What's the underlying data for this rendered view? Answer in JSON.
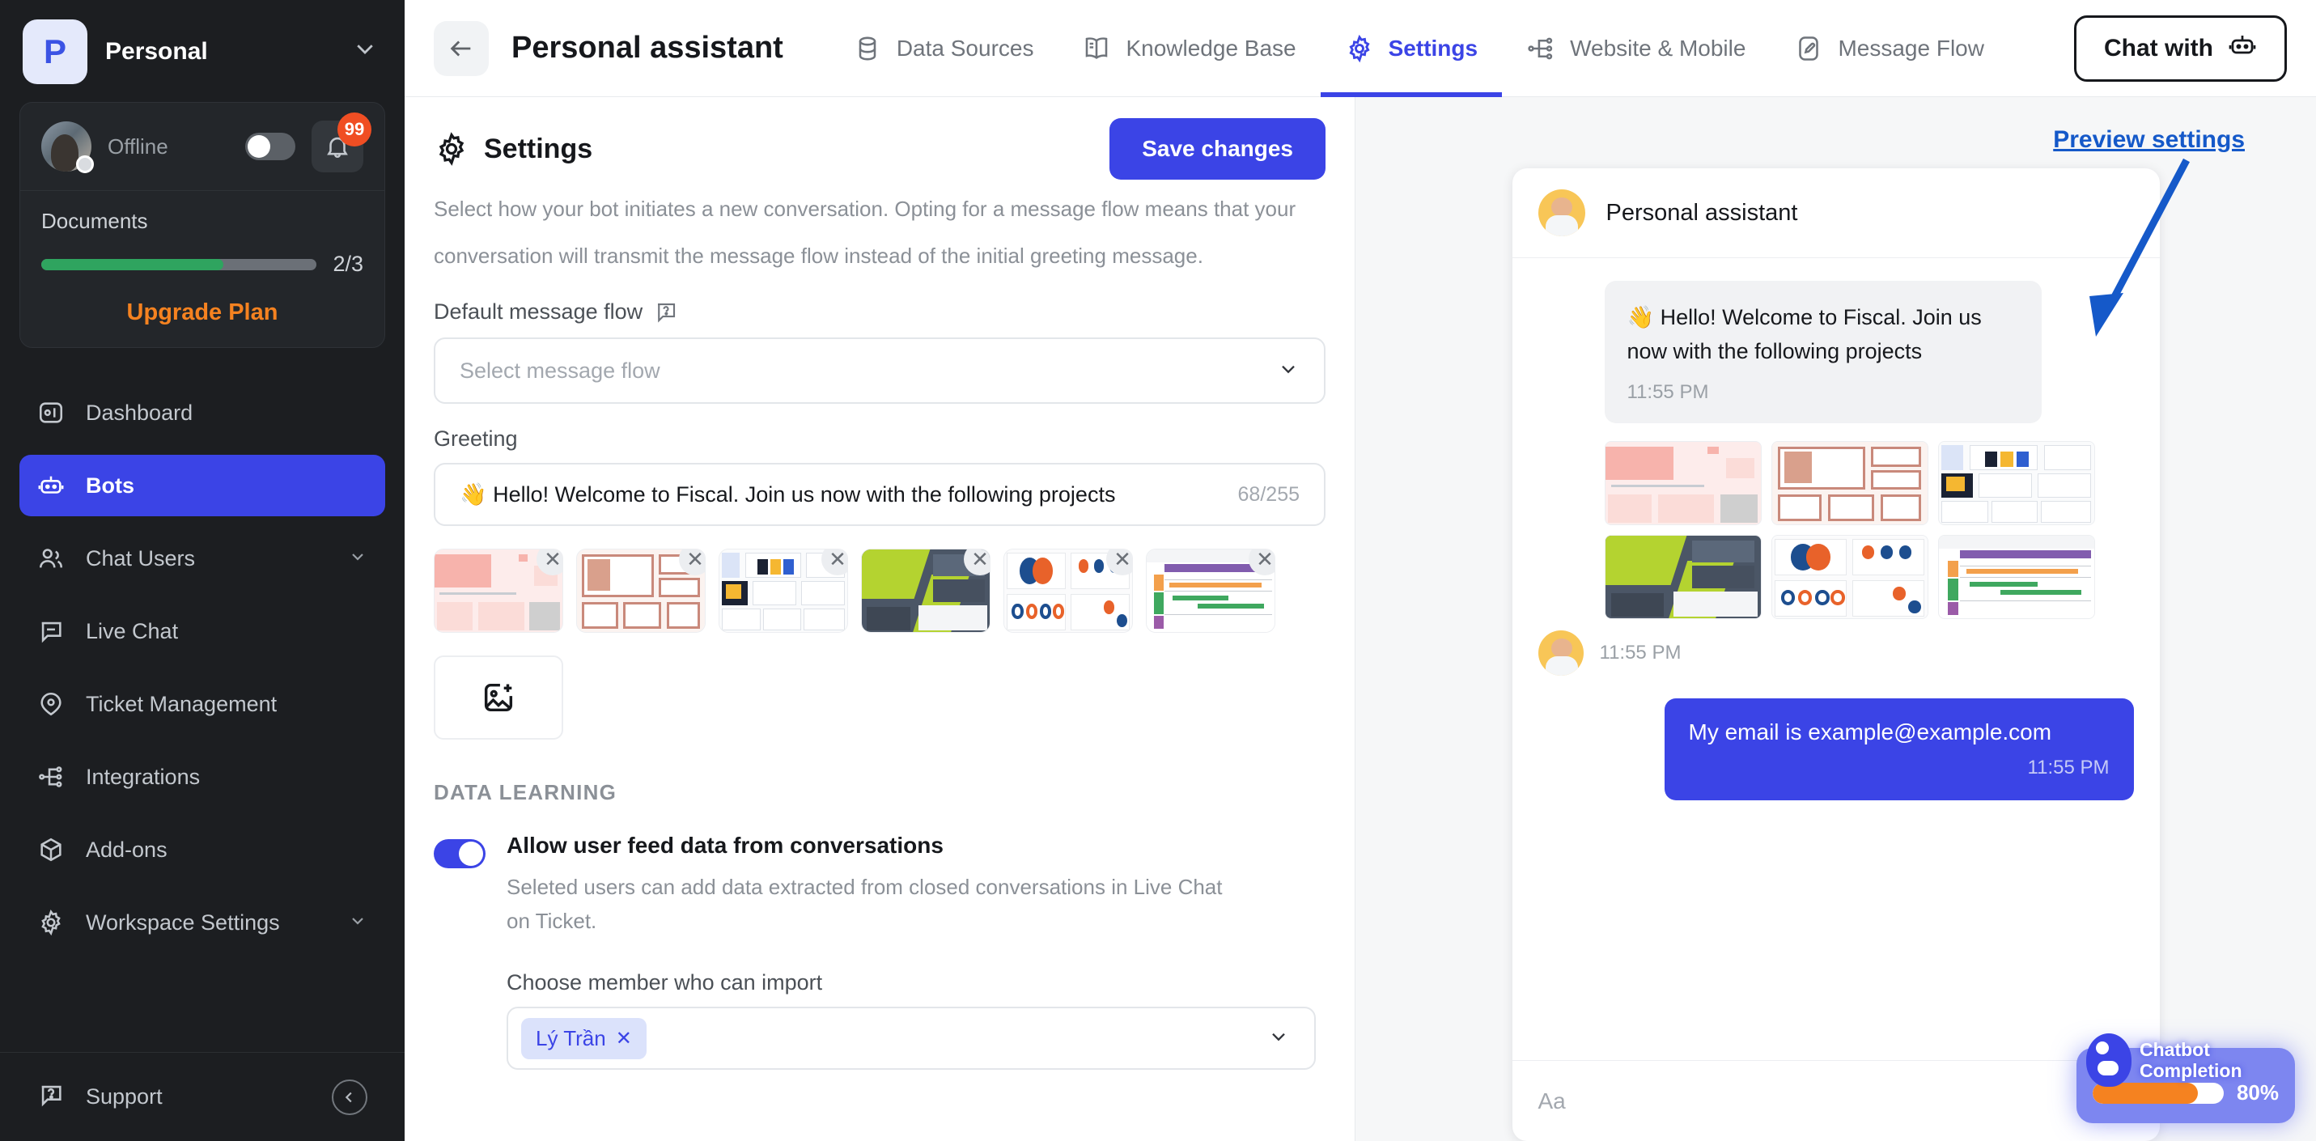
{
  "sidebar": {
    "workspace": {
      "initial": "P",
      "name": "Personal",
      "caret_icon": "chevron-down-icon"
    },
    "status": {
      "label": "Offline",
      "toggle_state": "off",
      "notification_count": "99",
      "bell_icon": "bell-icon"
    },
    "documents": {
      "label": "Documents",
      "count_text": "2/3",
      "progress_percent": 66,
      "upgrade_label": "Upgrade Plan"
    },
    "items": [
      {
        "label": "Dashboard",
        "icon": "dashboard-icon",
        "active": false,
        "expandable": false
      },
      {
        "label": "Bots",
        "icon": "robot-icon",
        "active": true,
        "expandable": false
      },
      {
        "label": "Chat Users",
        "icon": "users-icon",
        "active": false,
        "expandable": true
      },
      {
        "label": "Live Chat",
        "icon": "chat-bubble-icon",
        "active": false,
        "expandable": false
      },
      {
        "label": "Ticket Management",
        "icon": "tag-icon",
        "active": false,
        "expandable": false
      },
      {
        "label": "Integrations",
        "icon": "nodes-icon",
        "active": false,
        "expandable": false
      },
      {
        "label": "Add-ons",
        "icon": "box-icon",
        "active": false,
        "expandable": false
      },
      {
        "label": "Workspace Settings",
        "icon": "gear-icon",
        "active": false,
        "expandable": true
      }
    ],
    "footer": {
      "support_label": "Support",
      "support_icon": "question-bubble-icon",
      "collapse_icon": "chevron-left-icon"
    }
  },
  "topbar": {
    "back_icon": "arrow-left-icon",
    "bot_title": "Personal assistant",
    "tabs": [
      {
        "label": "Data Sources",
        "icon": "database-icon",
        "active": false
      },
      {
        "label": "Knowledge Base",
        "icon": "book-icon",
        "active": false
      },
      {
        "label": "Settings",
        "icon": "gear-icon",
        "active": true
      },
      {
        "label": "Website & Mobile",
        "icon": "nodes-icon",
        "active": false
      },
      {
        "label": "Message Flow",
        "icon": "pen-square-icon",
        "active": false
      }
    ],
    "chat_with": {
      "label": "Chat with",
      "icon": "robot-icon"
    }
  },
  "settings": {
    "title": "Settings",
    "title_icon": "gear-icon",
    "save_label": "Save changes",
    "description_clipped": "Select how your bot initiates a new conversation. Opting for a message flow means that your",
    "description_line2": "conversation will transmit the message flow instead of the initial greeting message.",
    "message_flow": {
      "label": "Default message flow",
      "help_icon": "question-icon",
      "placeholder": "Select message flow",
      "caret_icon": "chevron-down-icon"
    },
    "greeting": {
      "label": "Greeting",
      "value": "👋 Hello! Welcome to Fiscal. Join us now with the following projects",
      "char_count": "68/255"
    },
    "attachments": [
      {
        "name": "slide-pink-presentation-title",
        "style": "pink",
        "close_icon": "close-icon"
      },
      {
        "name": "slide-rose-this-is-your-title",
        "style": "rose",
        "close_icon": "close-icon"
      },
      {
        "name": "slide-blue-price-table",
        "style": "blue",
        "close_icon": "close-icon"
      },
      {
        "name": "slide-green-presentation",
        "style": "green",
        "close_icon": "close-icon"
      },
      {
        "name": "slide-business-infographics",
        "style": "infog",
        "close_icon": "close-icon"
      },
      {
        "name": "slide-gantt-timeline",
        "style": "gantt",
        "close_icon": "close-icon"
      }
    ],
    "add_image_icon": "add-image-icon",
    "data_learning": {
      "section_label": "DATA LEARNING",
      "toggle_state": "on",
      "toggle_title": "Allow user feed data from conversations",
      "toggle_desc": "Seleted users can add data extracted from closed conversations in Live Chat on Ticket.",
      "member_label": "Choose member who can import",
      "member_chips": [
        {
          "name": "Lý Trần",
          "remove_icon": "close-icon"
        }
      ],
      "caret_icon": "chevron-down-icon"
    }
  },
  "preview": {
    "annotation": "Preview settings",
    "annotation_arrow_icon": "arrow-down-left-icon",
    "bot_name": "Personal assistant",
    "bot_avatar": "avatar",
    "messages": [
      {
        "from": "bot",
        "text": "👋 Hello! Welcome to Fiscal. Join us now with the following projects",
        "time": "11:55 PM"
      },
      {
        "from": "bot",
        "type": "images",
        "time": "11:55 PM",
        "images": [
          {
            "name": "slide-pink-presentation-title",
            "style": "pink"
          },
          {
            "name": "slide-rose-this-is-your-title",
            "style": "rose"
          },
          {
            "name": "slide-blue-price-table",
            "style": "blue"
          },
          {
            "name": "slide-green-presentation",
            "style": "green"
          },
          {
            "name": "slide-business-infographics",
            "style": "infog"
          },
          {
            "name": "slide-gantt-timeline",
            "style": "gantt"
          }
        ]
      },
      {
        "from": "user",
        "text": "My email is example@example.com",
        "time": "11:55 PM"
      }
    ],
    "input_placeholder": "Aa",
    "send_icon": "send-icon"
  },
  "completion_widget": {
    "label_line1": "Chatbot",
    "label_line2": "Completion",
    "percent_text": "80%",
    "percent_value": 80,
    "logo_icon": "chatbot-logo-icon"
  },
  "colors": {
    "accent_blue": "#3b44e6",
    "sidebar_bg": "#1c1e21",
    "orange": "#f58220",
    "green": "#2fa45f",
    "badge_red": "#f04e23",
    "annotation_blue": "#1559c9"
  }
}
